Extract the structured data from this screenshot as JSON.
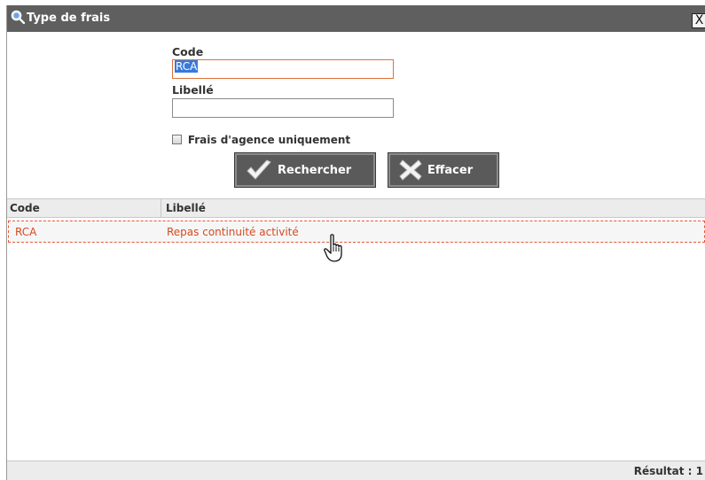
{
  "dialog": {
    "title": "Type de frais",
    "close_label": "X"
  },
  "form": {
    "code_label": "Code",
    "code_value": "RCA",
    "libelle_label": "Libellé",
    "libelle_value": "",
    "agency_only_label": "Frais d'agence uniquement",
    "agency_only_checked": false
  },
  "buttons": {
    "search_label": "Rechercher",
    "clear_label": "Effacer"
  },
  "grid": {
    "columns": [
      "Code",
      "Libellé"
    ],
    "rows": [
      {
        "code": "RCA",
        "libelle": "Repas continuité activité"
      }
    ]
  },
  "footer": {
    "result_text": "Résultat : 1"
  },
  "colors": {
    "titlebar": "#5f5f5f",
    "row_text": "#d64a1f",
    "row_border": "#e35b3a",
    "focus_border": "#e0703a",
    "selection": "#3879d9"
  },
  "icons": {
    "title": "magnifier-icon",
    "search_button": "checkmark-icon",
    "clear_button": "x-mark-icon",
    "cursor": "hand-pointer-icon"
  }
}
